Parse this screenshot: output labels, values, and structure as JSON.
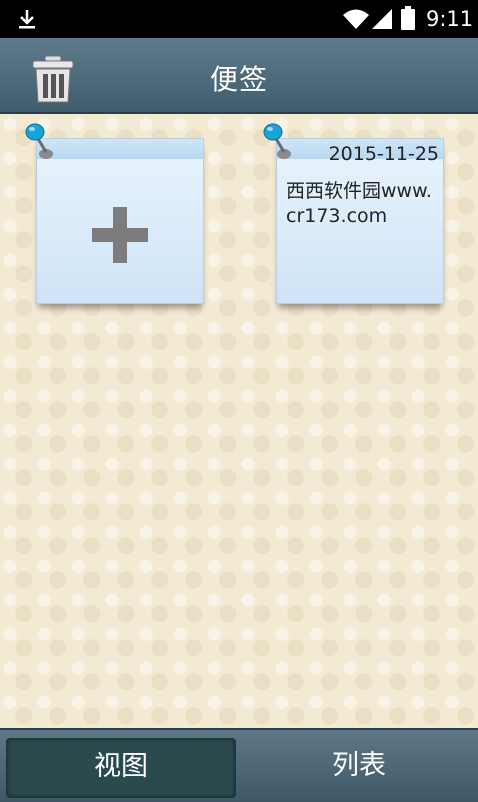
{
  "status_bar": {
    "time": "9:11",
    "icons": [
      "download-icon",
      "wifi-icon",
      "signal-icon",
      "battery-icon"
    ]
  },
  "header": {
    "title": "便签",
    "trash_icon": "trash-icon"
  },
  "notes": {
    "add_icon": "plus-icon",
    "items": [
      {
        "date": "2015-11-25",
        "text": "西西软件园www.cr173.com"
      }
    ]
  },
  "tabs": [
    {
      "label": "视图",
      "selected": true
    },
    {
      "label": "列表",
      "selected": false
    }
  ],
  "colors": {
    "header": "#4d6878",
    "note": "#dfeefb",
    "pin": "#1aa3d6",
    "selected_tab": "#2a4a4d",
    "background": "#f3ead3"
  }
}
